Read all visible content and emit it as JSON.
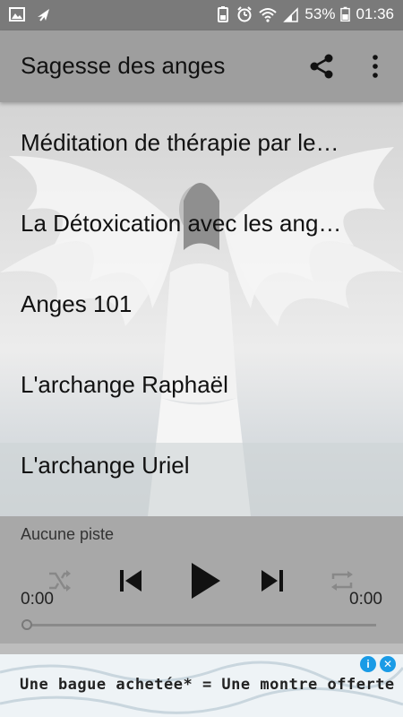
{
  "status_bar": {
    "battery_percent": "53%",
    "time": "01:36",
    "left_icons": [
      "gallery-icon",
      "airplane-icon"
    ],
    "right_icons": [
      "battery-saver-icon",
      "alarm-icon",
      "wifi-icon",
      "signal-icon",
      "battery-icon"
    ]
  },
  "app_bar": {
    "title": "Sagesse des anges",
    "actions": [
      "share-icon",
      "more-vert-icon"
    ]
  },
  "list": {
    "items": [
      {
        "label": "Méditation de thérapie par le…"
      },
      {
        "label": "La Détoxication avec les ang…"
      },
      {
        "label": "Anges 101"
      },
      {
        "label": "L'archange Raphaël"
      },
      {
        "label": "L'archange Uriel"
      }
    ]
  },
  "player": {
    "track_title": "Aucune piste",
    "elapsed": "0:00",
    "duration": "0:00",
    "progress": 0,
    "controls": [
      "shuffle-icon",
      "skip-previous-icon",
      "play-icon",
      "skip-next-icon",
      "repeat-icon"
    ]
  },
  "ad": {
    "text": "Une bague achetée* = Une montre offerte",
    "badges": [
      "info-icon",
      "close-icon"
    ]
  },
  "colors": {
    "status_bar": "#7a7a7a",
    "app_bar": "#9e9e9e",
    "player": "#a8a8a8",
    "ad_info": "#1a9be6"
  }
}
